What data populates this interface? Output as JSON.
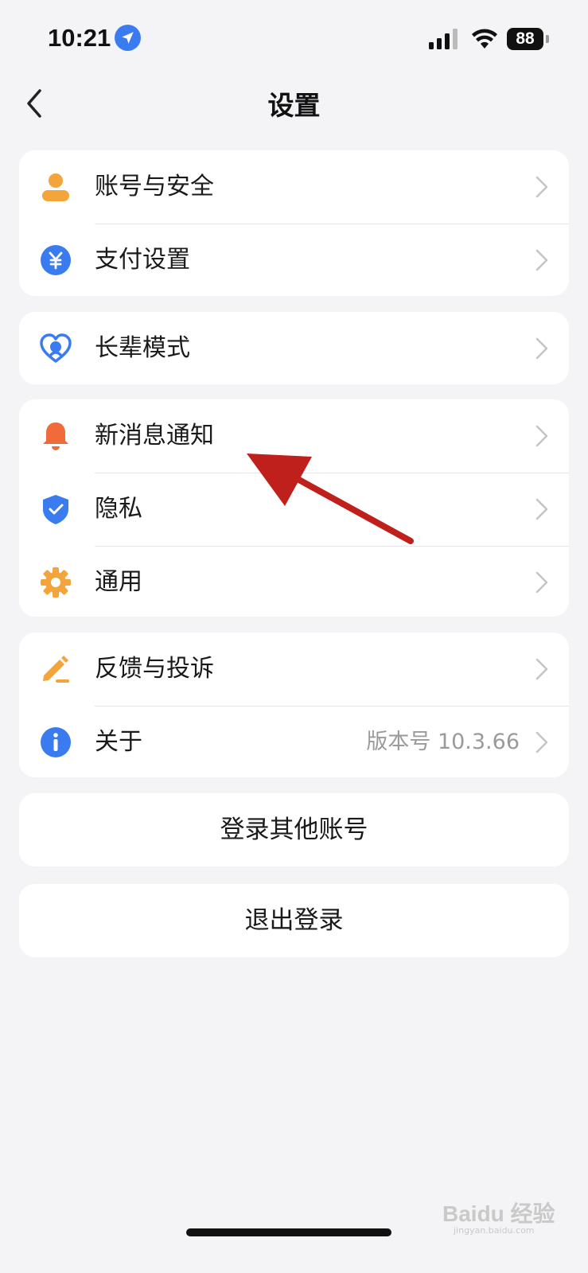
{
  "status_bar": {
    "time": "10:21",
    "battery": "88",
    "icons": [
      "location-arrow-icon",
      "cellular-signal-icon",
      "wifi-icon",
      "battery-icon"
    ]
  },
  "header": {
    "title": "设置",
    "back_icon": "chevron-left-icon"
  },
  "groups": [
    {
      "items": [
        {
          "label": "账号与安全",
          "icon": "user-icon",
          "icon_color": "#f3a43a"
        },
        {
          "label": "支付设置",
          "icon": "yuan-coin-icon",
          "icon_color": "#3a7cf0"
        }
      ]
    },
    {
      "items": [
        {
          "label": "长辈模式",
          "icon": "heart-icon",
          "icon_color": "#3a7cf0"
        }
      ]
    },
    {
      "items": [
        {
          "label": "新消息通知",
          "icon": "bell-icon",
          "icon_color": "#f06a3a"
        },
        {
          "label": "隐私",
          "icon": "shield-icon",
          "icon_color": "#3a7cf0"
        },
        {
          "label": "通用",
          "icon": "gear-icon",
          "icon_color": "#f3a43a"
        }
      ]
    },
    {
      "items": [
        {
          "label": "反馈与投诉",
          "icon": "pencil-icon",
          "icon_color": "#f3a43a"
        },
        {
          "label": "关于",
          "icon": "info-icon",
          "icon_color": "#3a7cf0",
          "value": "版本号 10.3.66"
        }
      ]
    }
  ],
  "buttons": {
    "switch_account": "登录其他账号",
    "logout": "退出登录"
  },
  "annotation": {
    "color": "#c0201c"
  },
  "watermark": {
    "brand": "Baidu 经验",
    "sub": "jingyan.baidu.com"
  }
}
